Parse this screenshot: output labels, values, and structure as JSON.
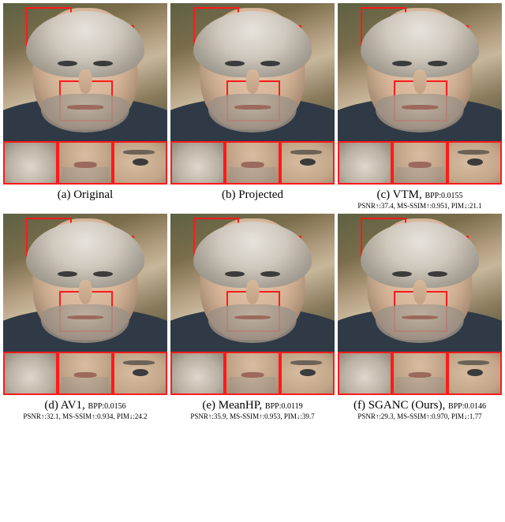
{
  "panels": [
    {
      "id": "a",
      "letter": "(a)",
      "name": "Original",
      "bpp": null,
      "psnr": null,
      "msssim": null,
      "pim": null
    },
    {
      "id": "b",
      "letter": "(b)",
      "name": "Projected",
      "bpp": null,
      "psnr": null,
      "msssim": null,
      "pim": null
    },
    {
      "id": "c",
      "letter": "(c)",
      "name": "VTM",
      "bpp": "0.0155",
      "psnr": "37.4",
      "msssim": "0.951",
      "pim": "21.1"
    },
    {
      "id": "d",
      "letter": "(d)",
      "name": "AV1",
      "bpp": "0.0156",
      "psnr": "32.1",
      "msssim": "0.934",
      "pim": "24.2"
    },
    {
      "id": "e",
      "letter": "(e)",
      "name": "MeanHP",
      "bpp": "0.0119",
      "psnr": "35.9",
      "msssim": "0.953",
      "pim": "39.7"
    },
    {
      "id": "f",
      "letter": "(f)",
      "name": "SGANC (Ours)",
      "bpp": "0.0146",
      "psnr": "29.3",
      "msssim": "0.970",
      "pim": "1.77"
    }
  ],
  "labels": {
    "bpp_prefix": "BPP:",
    "psnr_prefix": "PSNR↑:",
    "msssim_prefix": "MS-SSIM↑:",
    "pim_prefix": "PIM↓:"
  },
  "roi_boxes": [
    "forehead",
    "right-eye",
    "mouth"
  ],
  "crop_strip_order": [
    "forehead-hair",
    "mouth-beard",
    "right-eye"
  ]
}
